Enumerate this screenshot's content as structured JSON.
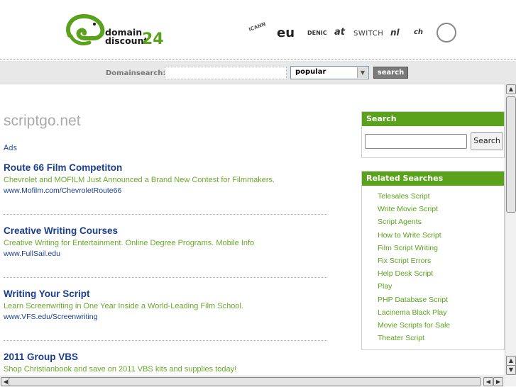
{
  "header": {
    "logo_line1": "domain",
    "logo_line2": "discount",
    "logo_number": "24",
    "registries": [
      "ICANN",
      "eu",
      "DENIC",
      "at",
      "SWITCH",
      "nl",
      "ch",
      "seal"
    ]
  },
  "searchbar": {
    "label": "Domainsearch:",
    "input_value": "",
    "select_value": "popular",
    "button_label": "search"
  },
  "main": {
    "domain_title": "scriptgo.net",
    "ads_label": "Ads",
    "ads": [
      {
        "title": "Route 66 Film Competiton",
        "description": "Chevrolet and MOFILM Just Announced a Brand New Contest for Filmmakers.",
        "url": "www.Mofilm.com/ChevroletRoute66"
      },
      {
        "title": "Creative Writing Courses",
        "description": "Creative Writing for Entertainment. Online Degree Programs. Mobile Info",
        "url": "www.FullSail.edu"
      },
      {
        "title": "Writing Your Script",
        "description": "Learn Screenwriting in One Year Inside a World-Leading Film School.",
        "url": "www.VFS.edu/Screenwriting"
      },
      {
        "title": "2011 Group VBS",
        "description": "Shop Christianbook and save on 2011 VBS kits and supplies today!",
        "url": ""
      }
    ]
  },
  "sidebar": {
    "search_title": "Search",
    "search_input_value": "",
    "search_button": "Search",
    "related_title": "Related Searches",
    "related": [
      "Telesales Script",
      "Write Movie Script",
      "Script Agents",
      "How to Write Script",
      "Film Script Writing",
      "Fix Script Errors",
      "Help Desk Script",
      "Play",
      "PHP Database Script",
      "Lacinema Black Play",
      "Movie Scripts for Sale",
      "Theater Script"
    ]
  },
  "colors": {
    "accent": "#5aa21c",
    "link": "#1a3d8f",
    "ad_desc": "#6aa82c"
  }
}
